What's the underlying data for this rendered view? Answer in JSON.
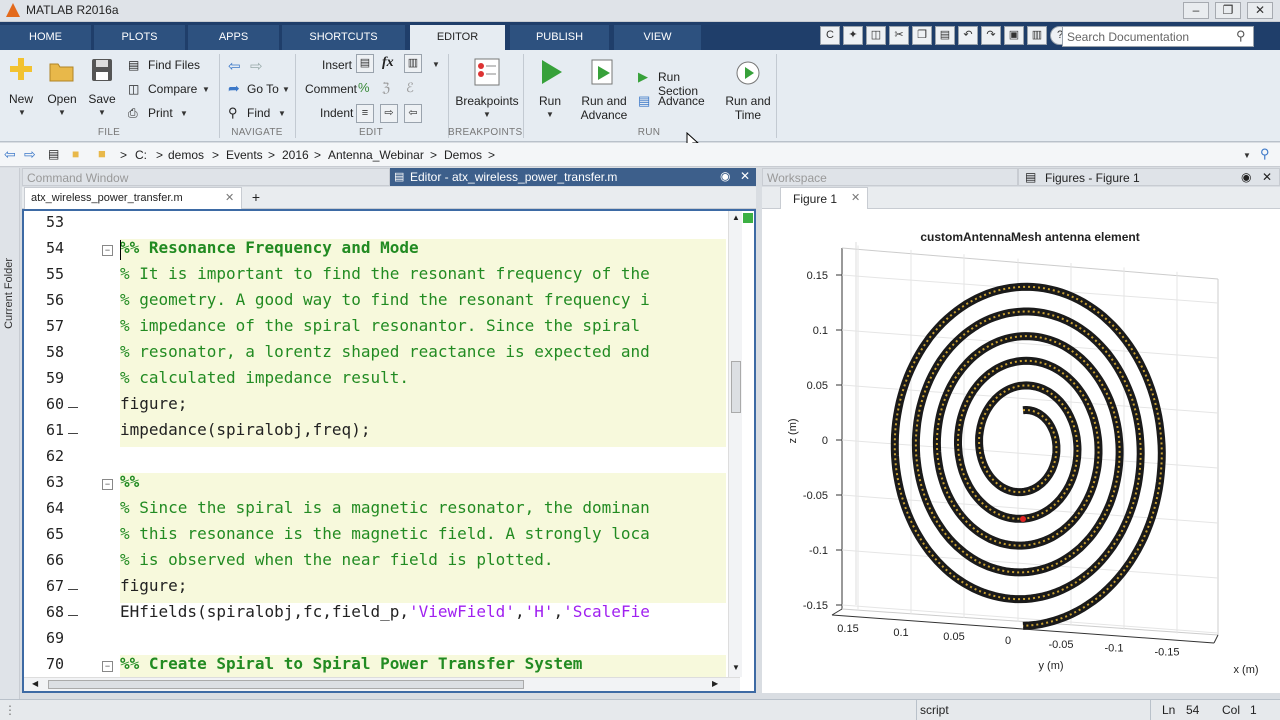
{
  "app": {
    "title": "MATLAB R2016a"
  },
  "tabs": [
    {
      "label": "HOME"
    },
    {
      "label": "PLOTS"
    },
    {
      "label": "APPS"
    },
    {
      "label": "SHORTCUTS"
    },
    {
      "label": "EDITOR"
    },
    {
      "label": "PUBLISH"
    },
    {
      "label": "VIEW"
    }
  ],
  "search": {
    "placeholder": "Search Documentation"
  },
  "ribbon": {
    "file": {
      "section": "FILE",
      "new": "New",
      "open": "Open",
      "save": "Save",
      "find_files": "Find Files",
      "compare": "Compare",
      "print": "Print"
    },
    "navigate": {
      "section": "NAVIGATE",
      "go_to": "Go To",
      "find": "Find"
    },
    "edit": {
      "section": "EDIT",
      "insert": "Insert",
      "comment": "Comment",
      "indent": "Indent",
      "fx": "fx"
    },
    "breakpoints": {
      "section": "BREAKPOINTS",
      "label": "Breakpoints"
    },
    "run": {
      "section": "RUN",
      "run": "Run",
      "run_and_advance_1": "Run and",
      "run_and_advance_2": "Advance",
      "run_section": "Run Section",
      "advance": "Advance",
      "run_and_time_1": "Run and",
      "run_and_time_2": "Time"
    }
  },
  "address": {
    "sep": ">",
    "crumbs": [
      "C:",
      "demos",
      "Events",
      "2016",
      "Antenna_Webinar",
      "Demos"
    ]
  },
  "panels": {
    "command_window": "Command Window",
    "current_folder": "Current Folder",
    "editor_title": "Editor - atx_wireless_power_transfer.m",
    "editor_tab": "atx_wireless_power_transfer.m",
    "add_tab": "+",
    "workspace": "Workspace",
    "figures_title": "Figures - Figure 1",
    "figure_tab": "Figure 1"
  },
  "code": {
    "lines": [
      {
        "num": "53",
        "parts": []
      },
      {
        "num": "54",
        "parts": [
          {
            "t": "%% Resonance Frequency and Mode",
            "c": "cell"
          }
        ]
      },
      {
        "num": "55",
        "parts": [
          {
            "t": "% It is important to find the resonant frequency of the",
            "c": "cmt"
          }
        ]
      },
      {
        "num": "56",
        "parts": [
          {
            "t": "% geometry. A good way to find the resonant frequency i",
            "c": "cmt"
          }
        ]
      },
      {
        "num": "57",
        "parts": [
          {
            "t": "% impedance of the spiral resonantor. Since the spiral",
            "c": "cmt"
          }
        ]
      },
      {
        "num": "58",
        "parts": [
          {
            "t": "% resonator, a lorentz shaped reactance is expected and",
            "c": "cmt"
          }
        ]
      },
      {
        "num": "59",
        "parts": [
          {
            "t": "% calculated impedance result.",
            "c": "cmt"
          }
        ]
      },
      {
        "num": "60",
        "parts": [
          {
            "t": "figure;",
            "c": ""
          }
        ]
      },
      {
        "num": "61",
        "parts": [
          {
            "t": "impedance(spiralobj,freq);",
            "c": ""
          }
        ]
      },
      {
        "num": "62",
        "parts": []
      },
      {
        "num": "63",
        "parts": [
          {
            "t": "%%",
            "c": "cell"
          }
        ]
      },
      {
        "num": "64",
        "parts": [
          {
            "t": "% Since the spiral is a magnetic resonator, the dominan",
            "c": "cmt"
          }
        ]
      },
      {
        "num": "65",
        "parts": [
          {
            "t": "% this resonance is the magnetic field. A strongly loca",
            "c": "cmt"
          }
        ]
      },
      {
        "num": "66",
        "parts": [
          {
            "t": "% is observed when the near field is plotted.",
            "c": "cmt"
          }
        ]
      },
      {
        "num": "67",
        "parts": [
          {
            "t": "figure;",
            "c": ""
          }
        ]
      },
      {
        "num": "68",
        "parts": [
          {
            "t": "EHfields(spiralobj,fc,field_p,",
            "c": ""
          },
          {
            "t": "'ViewField'",
            "c": "str"
          },
          {
            "t": ",",
            "c": ""
          },
          {
            "t": "'H'",
            "c": "str"
          },
          {
            "t": ",",
            "c": ""
          },
          {
            "t": "'ScaleFie",
            "c": "str"
          }
        ]
      },
      {
        "num": "69",
        "parts": []
      },
      {
        "num": "70",
        "parts": [
          {
            "t": "%% Create Spiral to Spiral Power Transfer System",
            "c": "cell"
          }
        ]
      }
    ]
  },
  "figure": {
    "title": "customAntennaMesh antenna element",
    "zlabel": "z (m)",
    "ylabel": "y (m)",
    "xlabel": "x (m)",
    "zticks": [
      "0.15",
      "0.1",
      "0.05",
      "0",
      "-0.05",
      "-0.1",
      "-0.15"
    ],
    "yticks": [
      "0.15",
      "0.1",
      "0.05",
      "0",
      "-0.05",
      "-0.1",
      "-0.15"
    ]
  },
  "status": {
    "mode": "script",
    "ln_label": "Ln",
    "ln": "54",
    "col_label": "Col",
    "col": "1"
  }
}
